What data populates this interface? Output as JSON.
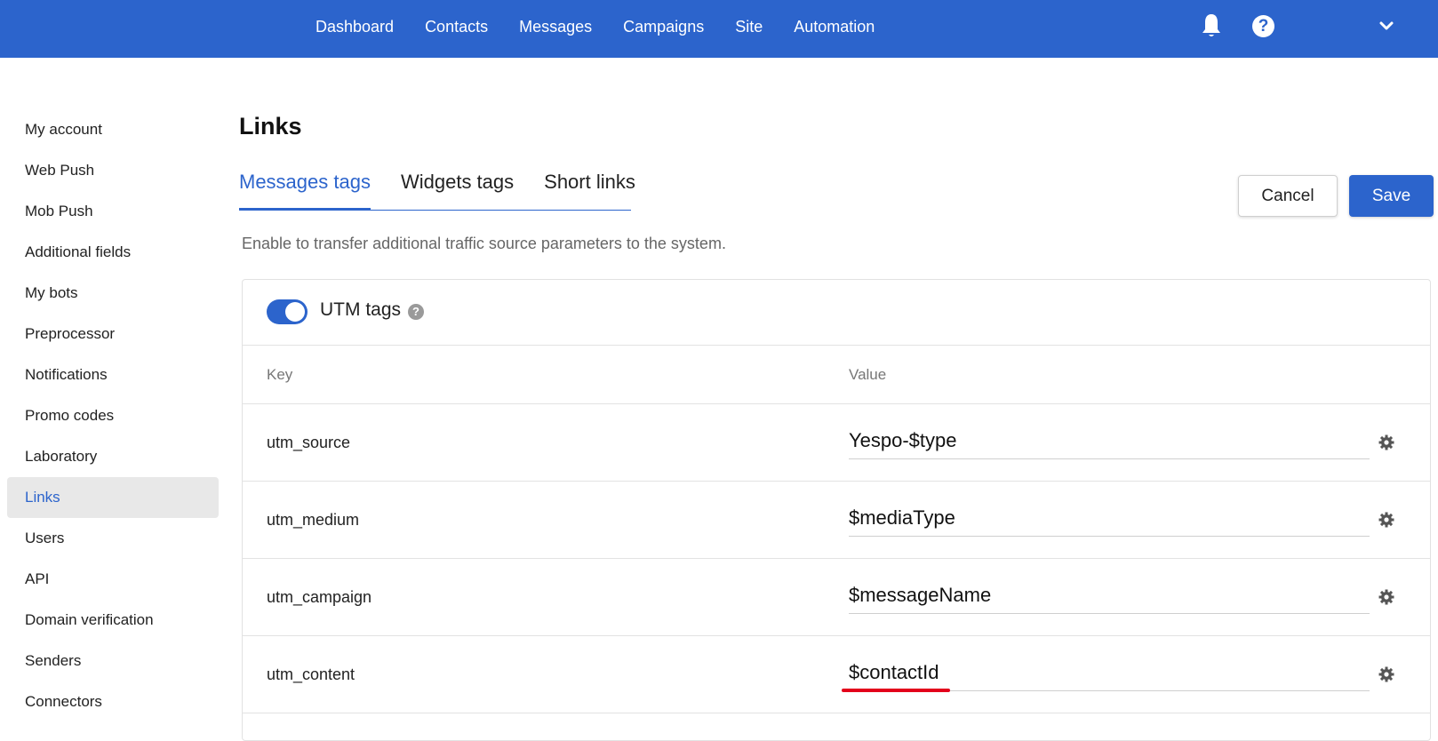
{
  "nav": {
    "items": [
      "Dashboard",
      "Contacts",
      "Messages",
      "Campaigns",
      "Site",
      "Automation"
    ],
    "help_label": "?"
  },
  "sidebar": {
    "items": [
      "My account",
      "Web Push",
      "Mob Push",
      "Additional fields",
      "My bots",
      "Preprocessor",
      "Notifications",
      "Promo codes",
      "Laboratory",
      "Links",
      "Users",
      "API",
      "Domain verification",
      "Senders",
      "Connectors"
    ],
    "active": "Links"
  },
  "page": {
    "title": "Links",
    "tabs": [
      "Messages tags",
      "Widgets tags",
      "Short links"
    ],
    "active_tab": "Messages tags",
    "description": "Enable to transfer additional traffic source parameters to the system.",
    "cancel_label": "Cancel",
    "save_label": "Save"
  },
  "utm": {
    "label": "UTM tags",
    "enabled": true,
    "help_label": "?",
    "columns": {
      "key": "Key",
      "value": "Value"
    },
    "rows": [
      {
        "key": "utm_source",
        "value": "Yespo-$type"
      },
      {
        "key": "utm_medium",
        "value": "$mediaType"
      },
      {
        "key": "utm_campaign",
        "value": "$messageName"
      },
      {
        "key": "utm_content",
        "value": "$contactId"
      }
    ]
  },
  "colors": {
    "primary": "#2c64cc",
    "active_bg": "#e8e8e8",
    "annotation_red": "#e3001b"
  }
}
